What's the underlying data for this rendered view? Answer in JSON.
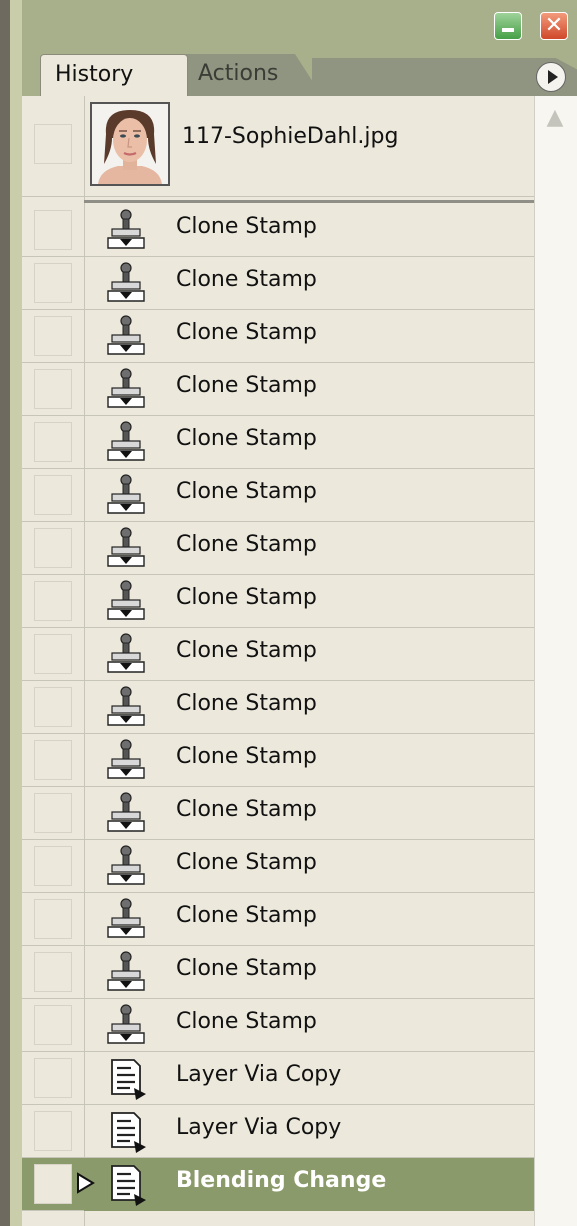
{
  "panel": {
    "tabs": [
      {
        "label": "History",
        "active": true
      },
      {
        "label": "Actions",
        "active": false
      }
    ],
    "colors": {
      "frame": "#a7b08a",
      "list_bg": "#ece9dc",
      "selected": "#8b9a6a"
    }
  },
  "snapshot": {
    "label": "117-SophieDahl.jpg"
  },
  "history": {
    "items": [
      {
        "label": "Clone Stamp",
        "icon": "clone-stamp-icon"
      },
      {
        "label": "Clone Stamp",
        "icon": "clone-stamp-icon"
      },
      {
        "label": "Clone Stamp",
        "icon": "clone-stamp-icon"
      },
      {
        "label": "Clone Stamp",
        "icon": "clone-stamp-icon"
      },
      {
        "label": "Clone Stamp",
        "icon": "clone-stamp-icon"
      },
      {
        "label": "Clone Stamp",
        "icon": "clone-stamp-icon"
      },
      {
        "label": "Clone Stamp",
        "icon": "clone-stamp-icon"
      },
      {
        "label": "Clone Stamp",
        "icon": "clone-stamp-icon"
      },
      {
        "label": "Clone Stamp",
        "icon": "clone-stamp-icon"
      },
      {
        "label": "Clone Stamp",
        "icon": "clone-stamp-icon"
      },
      {
        "label": "Clone Stamp",
        "icon": "clone-stamp-icon"
      },
      {
        "label": "Clone Stamp",
        "icon": "clone-stamp-icon"
      },
      {
        "label": "Clone Stamp",
        "icon": "clone-stamp-icon"
      },
      {
        "label": "Clone Stamp",
        "icon": "clone-stamp-icon"
      },
      {
        "label": "Clone Stamp",
        "icon": "clone-stamp-icon"
      },
      {
        "label": "Clone Stamp",
        "icon": "clone-stamp-icon"
      },
      {
        "label": "Layer Via Copy",
        "icon": "document-icon"
      },
      {
        "label": "Layer Via Copy",
        "icon": "document-icon"
      },
      {
        "label": "Blending Change",
        "icon": "document-icon",
        "selected": true
      }
    ]
  }
}
